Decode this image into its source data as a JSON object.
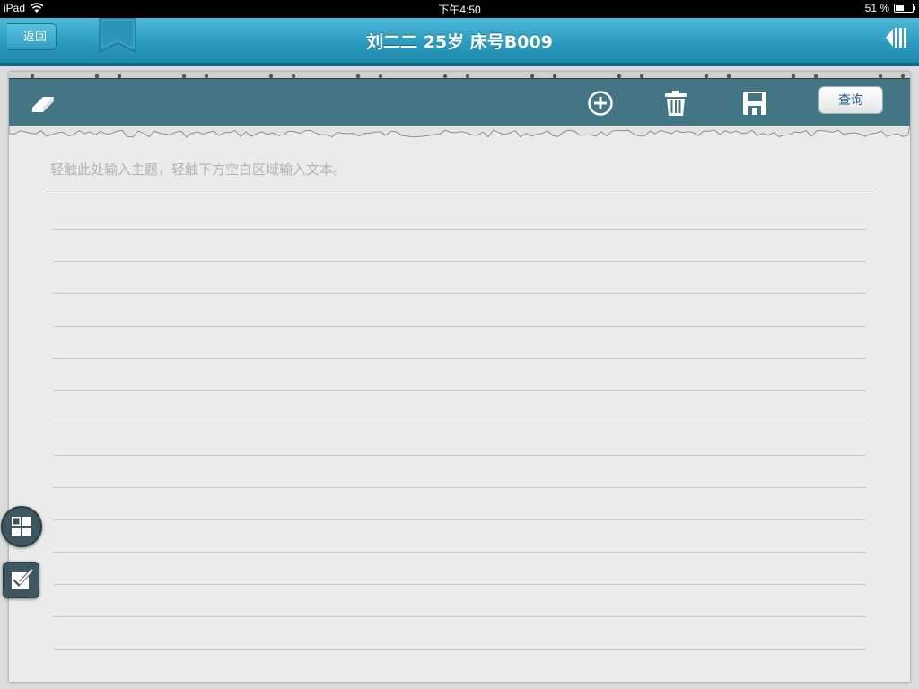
{
  "status_bar": {
    "device": "iPad",
    "time": "下午4:50",
    "battery": "51 %",
    "battery_level": 0.51
  },
  "nav": {
    "back_label": "返回",
    "title": "刘二二 25岁 床号B009"
  },
  "toolbar": {
    "query_label": "查询",
    "icons": [
      "eraser-icon",
      "add-circle-icon",
      "trash-icon",
      "save-icon"
    ]
  },
  "editor": {
    "subject_placeholder": "轻触此处输入主题，轻触下方空白区域输入文本。"
  },
  "colors": {
    "nav_accent": "#2b9cc0",
    "toolbar": "#437685",
    "paper": "#ebebeb"
  }
}
